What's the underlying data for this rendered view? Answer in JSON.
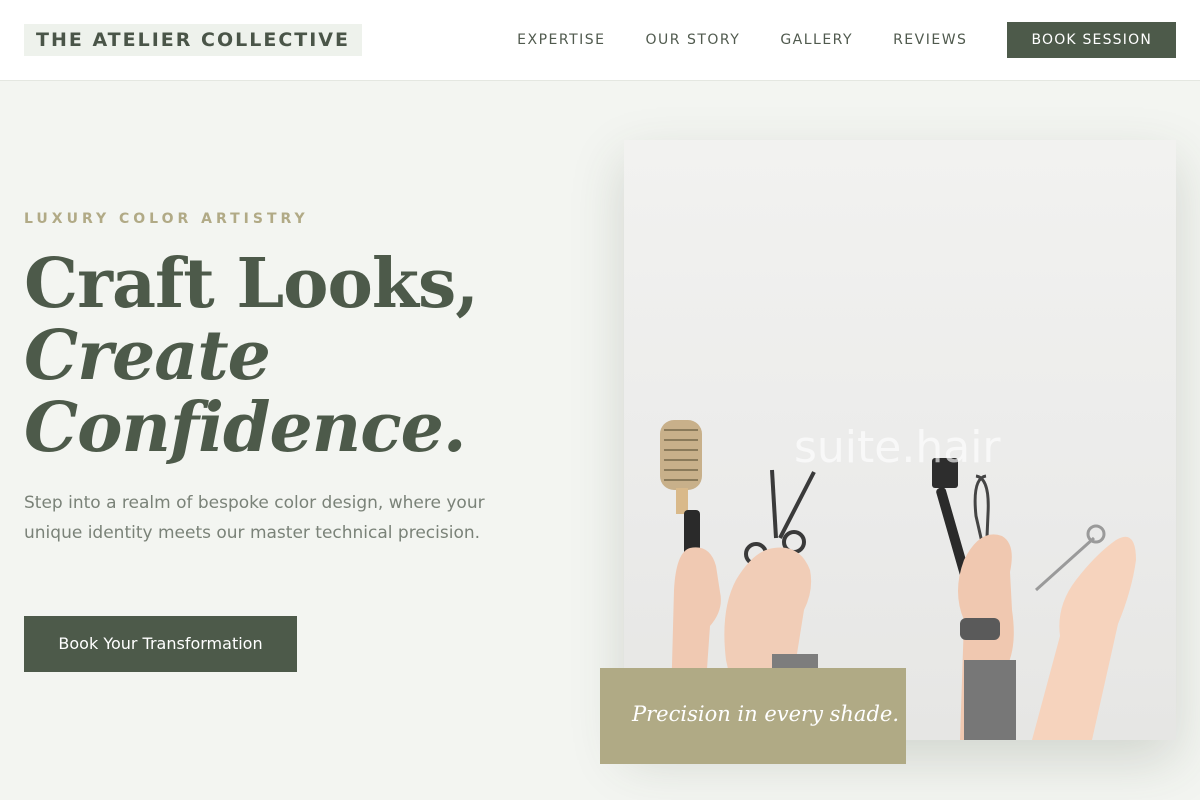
{
  "brand": {
    "name": "THE ATELIER COLLECTIVE"
  },
  "nav": {
    "links": [
      "EXPERTISE",
      "OUR STORY",
      "GALLERY",
      "REVIEWS"
    ],
    "cta": "BOOK SESSION"
  },
  "hero": {
    "eyebrow": "LUXURY COLOR ARTISTRY",
    "headline_line1": "Craft Looks,",
    "headline_line2": "Create",
    "headline_line3": "Confidence.",
    "lead": "Step into a realm of bespoke color design, where your unique identity meets our master technical precision.",
    "cta": "Book Your Transformation"
  },
  "photo": {
    "watermark": "suite.hair",
    "caption": "Precision in every shade."
  },
  "colors": {
    "primary": "#4d5a4a",
    "accent": "#b0aa85",
    "background": "#f3f5f1"
  }
}
